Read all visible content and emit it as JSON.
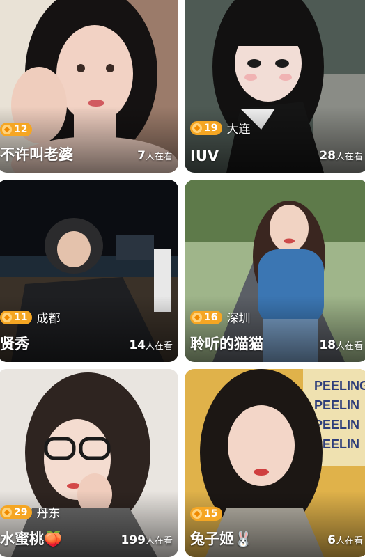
{
  "cards": [
    {
      "level": "12",
      "city": "",
      "name": "不许叫老婆",
      "viewers": "7",
      "viewers_suffix": "人在看"
    },
    {
      "level": "19",
      "city": "大连",
      "name": "IUV",
      "viewers": "28",
      "viewers_suffix": "人在看"
    },
    {
      "level": "11",
      "city": "成都",
      "name": "贤秀",
      "viewers": "14",
      "viewers_suffix": "人在看"
    },
    {
      "level": "16",
      "city": "深圳",
      "name": "聆听的猫猫",
      "viewers": "18",
      "viewers_suffix": "人在看"
    },
    {
      "level": "29",
      "city": "丹东",
      "name": "水蜜桃🍑",
      "viewers": "199",
      "viewers_suffix": "人在看"
    },
    {
      "level": "15",
      "city": "",
      "name": "兔子姬🐰",
      "viewers": "6",
      "viewers_suffix": "人在看"
    }
  ],
  "poster_text": "PEELING",
  "icons": {
    "badge": "level-badge-icon"
  }
}
